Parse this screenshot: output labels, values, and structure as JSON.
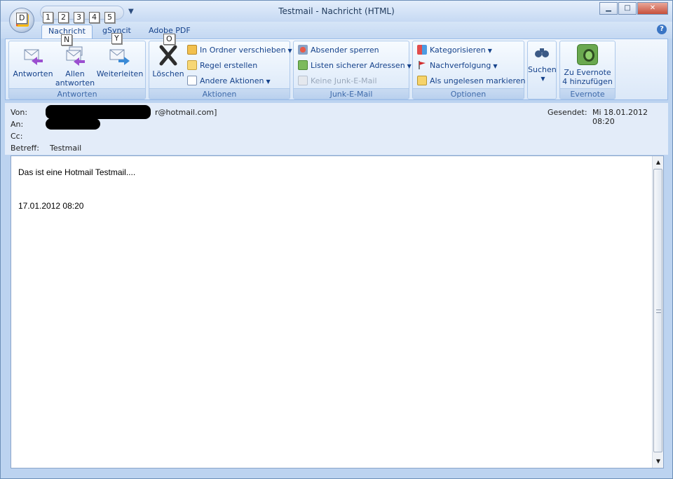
{
  "window": {
    "title": "Testmail - Nachricht (HTML)"
  },
  "keytips": {
    "office": "D",
    "qat": [
      "1",
      "2",
      "3",
      "4",
      "5"
    ],
    "tab": "N",
    "reply_all": "Y",
    "delete": "O"
  },
  "tabs": [
    {
      "label": "Nachricht",
      "active": true
    },
    {
      "label": "gSyncit",
      "active": false
    },
    {
      "label": "Adobe PDF",
      "active": false
    }
  ],
  "ribbon": {
    "antworten": {
      "label": "Antworten",
      "reply": "Antworten",
      "reply_all_1": "Allen",
      "reply_all_2": "antworten",
      "forward": "Weiterleiten"
    },
    "aktionen": {
      "label": "Aktionen",
      "delete": "Löschen",
      "move": "In Ordner verschieben",
      "rule": "Regel erstellen",
      "other": "Andere Aktionen"
    },
    "junk": {
      "label": "Junk-E-Mail",
      "block": "Absender sperren",
      "safe_lists": "Listen sicherer Adressen",
      "not_junk": "Keine Junk-E-Mail"
    },
    "optionen": {
      "label": "Optionen",
      "categorize": "Kategorisieren",
      "followup": "Nachverfolgung",
      "mark_unread": "Als ungelesen markieren"
    },
    "suchen": {
      "label": "Suchen"
    },
    "evernote": {
      "label": "Evernote",
      "add_1": "Zu Evernote",
      "add_2": "4 hinzufügen"
    }
  },
  "header": {
    "from_label": "Von:",
    "from_value": "r@hotmail.com]",
    "to_label": "An:",
    "cc_label": "Cc:",
    "subject_label": "Betreff:",
    "subject_value": "Testmail",
    "sent_label": "Gesendet:",
    "sent_value": "Mi 18.01.2012 08:20"
  },
  "body": {
    "line1": "Das ist eine Hotmail Testmail....",
    "line2": "17.01.2012 08:20"
  },
  "colors": {
    "ribbon_text": "#15428b",
    "frame": "#bcd3f0",
    "accent": "#3a75c4"
  }
}
